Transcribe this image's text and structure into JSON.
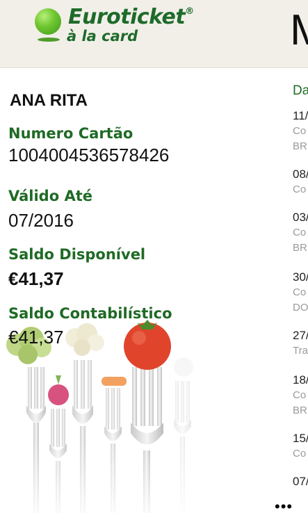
{
  "header": {
    "brand": "Euroticket",
    "brand_reg": "®",
    "brand_sub": "à la card",
    "next_page_glyph": "M"
  },
  "card": {
    "holder_name": "ANA RITA",
    "number_label": "Numero Cartão",
    "number_value": "1004004536578426",
    "valid_label": "Válido Até",
    "valid_value": "07/2016",
    "balance_label": "Saldo Disponível",
    "balance_value": "€41,37",
    "accounting_label": "Saldo Contabilístico",
    "accounting_value": "€41,37"
  },
  "movements": {
    "header": "Da",
    "items": [
      {
        "date": "11/0",
        "line2": "Co",
        "line3": "BR"
      },
      {
        "date": "08/",
        "line2": "Co",
        "line3": ""
      },
      {
        "date": "03/",
        "line2": "Co",
        "line3": "BR"
      },
      {
        "date": "30/",
        "line2": "Co",
        "line3": "DO"
      },
      {
        "date": "27/",
        "line2": "Tra",
        "line3": ""
      },
      {
        "date": "18/",
        "line2": "Co",
        "line3": "BR"
      },
      {
        "date": "15/",
        "line2": "Co",
        "line3": ""
      },
      {
        "date": "07/",
        "line2": "",
        "line3": ""
      }
    ]
  },
  "appbar": {
    "more_label": "•••"
  },
  "colors": {
    "brand_green": "#1e6b2a",
    "label_green": "#1f6a25",
    "header_bg": "#f2efe9"
  }
}
